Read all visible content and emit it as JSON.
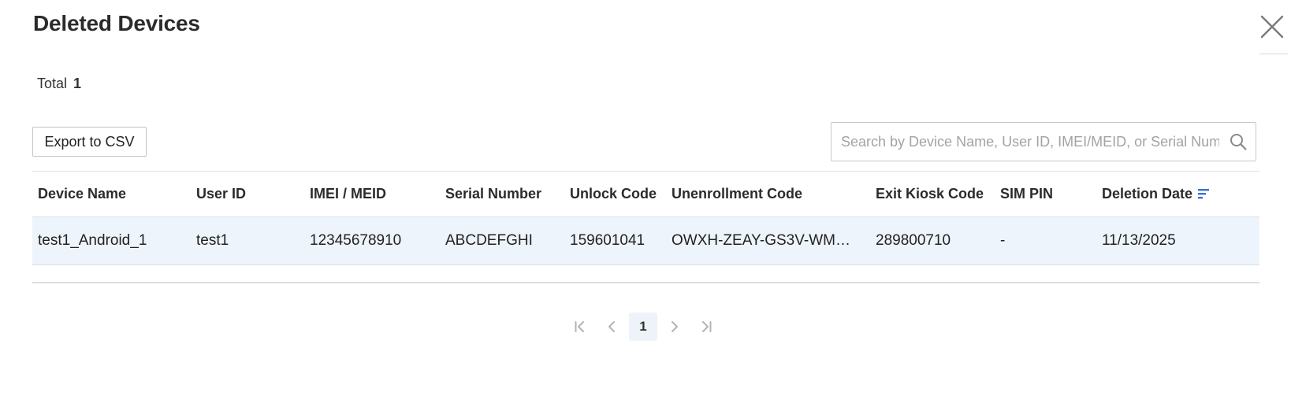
{
  "dialog": {
    "title": "Deleted Devices",
    "close_icon": "close-icon"
  },
  "summary": {
    "total_label": "Total",
    "total_count": "1"
  },
  "toolbar": {
    "export_label": "Export to CSV",
    "search_placeholder": "Search by Device Name, User ID, IMEI/MEID, or Serial Number",
    "search_icon": "search-icon"
  },
  "table": {
    "columns": [
      "Device Name",
      "User ID",
      "IMEI / MEID",
      "Serial Number",
      "Unlock Code",
      "Unenrollment Code",
      "Exit Kiosk Code",
      "SIM PIN",
      "Deletion Date"
    ],
    "sort": {
      "column": "Deletion Date",
      "icon": "sort-descending-icon",
      "color": "#3b6fd4"
    },
    "rows": [
      {
        "cells": [
          "test1_Android_1",
          "test1",
          "12345678910",
          "ABCDEFGHI",
          "159601041",
          "OWXH-ZEAY-GS3V-WM…",
          "289800710",
          "-",
          "11/13/2025"
        ]
      }
    ]
  },
  "pagination": {
    "current_page": "1",
    "icons": [
      "first-page-icon",
      "previous-page-icon",
      "next-page-icon",
      "last-page-icon"
    ]
  },
  "colors": {
    "selected_row_bg": "#eef4fb",
    "accent": "#3b6fd4"
  }
}
